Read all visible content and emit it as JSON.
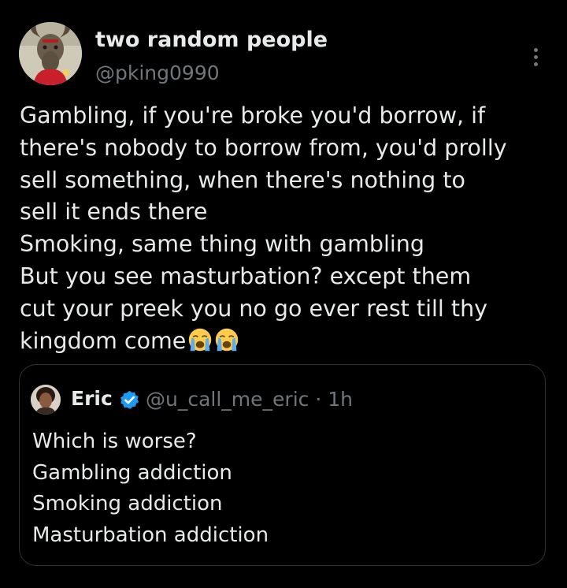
{
  "tweet": {
    "author": {
      "display_name": "two random people",
      "handle": "@pking0990",
      "avatar_icon": "goat-avatar"
    },
    "more_icon": "more-options-icon",
    "text_lines": [
      "Gambling, if you're broke you'd borrow, if",
      "there's nobody to borrow from, you'd prolly",
      "sell something, when there's nothing to",
      "sell it ends there",
      "Smoking, same thing with gambling",
      "But you see masturbation? except them",
      "cut your preek you no go ever rest till thy",
      "kingdom come"
    ],
    "trailing_emojis": [
      "loudly-crying-face",
      "loudly-crying-face"
    ]
  },
  "quote": {
    "author": {
      "display_name": "Eric",
      "verified": true,
      "verified_color": "#1d9bf0",
      "handle_time": "@u_call_me_eric · 1h",
      "avatar_icon": "profile-photo"
    },
    "text_lines": [
      "Which is worse?",
      "Gambling addiction",
      "Smoking addiction",
      "Masturbation addiction"
    ]
  },
  "colors": {
    "background": "#000000",
    "primary_text": "#e7e9ea",
    "secondary_text": "#71767b",
    "border": "#2f3336"
  }
}
